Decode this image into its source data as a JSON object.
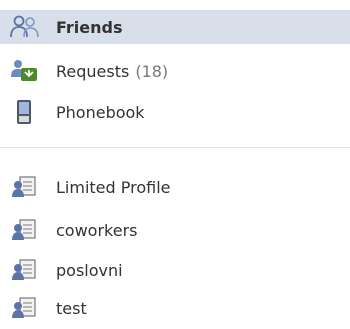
{
  "nav": {
    "friends": {
      "label": "Friends",
      "icon": "friends-icon"
    },
    "requests": {
      "label": "Requests",
      "count": "(18)",
      "icon": "friend-request-icon"
    },
    "phonebook": {
      "label": "Phonebook",
      "icon": "phone-icon"
    }
  },
  "lists": [
    {
      "label": "Limited Profile",
      "icon": "friend-list-icon"
    },
    {
      "label": "coworkers",
      "icon": "friend-list-icon"
    },
    {
      "label": "poslovni",
      "icon": "friend-list-icon"
    },
    {
      "label": "test",
      "icon": "friend-list-icon"
    }
  ],
  "colors": {
    "selected_bg": "#d8dfea",
    "text": "#333333",
    "count": "#777777",
    "divider": "#e4e4e4",
    "friends_icon": "#5b74a8",
    "requests_icon": "#4c8a2b"
  }
}
